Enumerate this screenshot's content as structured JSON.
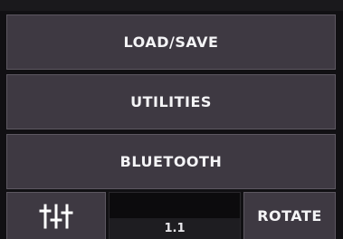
{
  "menu": {
    "load_save": "LOAD/SAVE",
    "utilities": "UTILITIES",
    "bluetooth": "BLUETOOTH"
  },
  "bottom_bar": {
    "mixer_icon": "sliders-icon",
    "version": "1.1",
    "rotate": "ROTATE"
  }
}
